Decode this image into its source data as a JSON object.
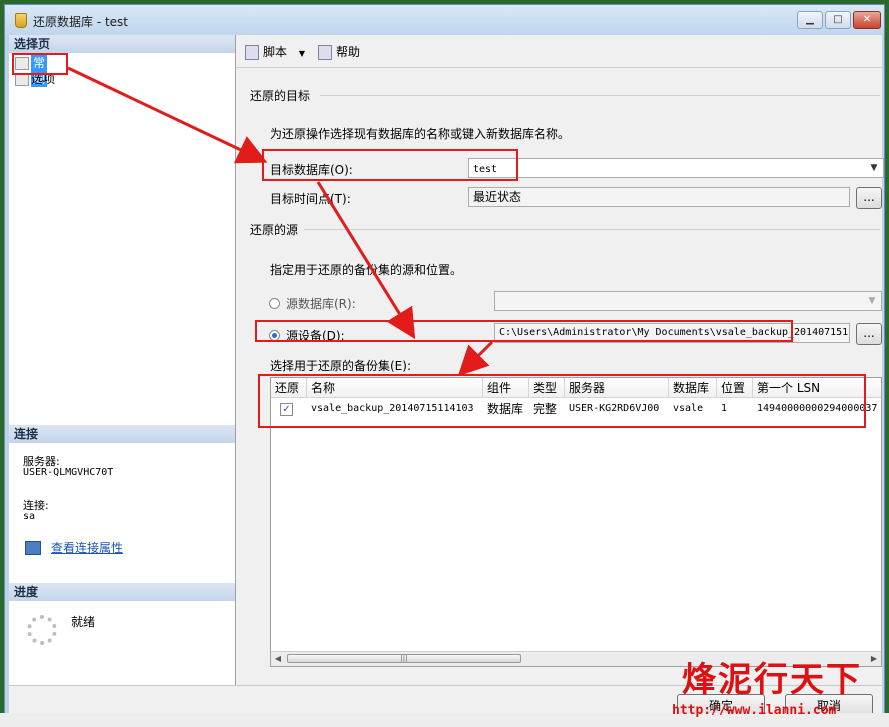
{
  "window": {
    "title": "还原数据库 - test"
  },
  "left": {
    "select_page_header": "选择页",
    "pages": [
      {
        "label": "常规"
      },
      {
        "label": "选项"
      }
    ],
    "connection_header": "连接",
    "server_label": "服务器:",
    "server_value": "USER-QLMGVHC70T",
    "conn_label": "连接:",
    "conn_value": "sa",
    "conn_props_link": "查看连接属性",
    "progress_header": "进度",
    "progress_status": "就绪"
  },
  "toolbar": {
    "script_label": "脚本",
    "help_label": "帮助"
  },
  "target": {
    "group_label": "还原的目标",
    "instruction": "为还原操作选择现有数据库的名称或键入新数据库名称。",
    "db_label": "目标数据库(O):",
    "db_value": "test",
    "time_label": "目标时间点(T):",
    "time_value": "最近状态",
    "ellipsis": "..."
  },
  "source": {
    "group_label": "还原的源",
    "instruction": "指定用于还原的备份集的源和位置。",
    "src_db_label": "源数据库(R):",
    "src_device_label": "源设备(D):",
    "device_value": "C:\\Users\\Administrator\\My Documents\\vsale_backup_201407151",
    "ellipsis": "..."
  },
  "backupsets": {
    "label": "选择用于还原的备份集(E):",
    "columns": [
      "还原",
      "名称",
      "组件",
      "类型",
      "服务器",
      "数据库",
      "位置",
      "第一个 LSN"
    ],
    "rows": [
      {
        "restore": "✓",
        "name": "vsale_backup_20140715114103",
        "component": "数据库",
        "type": "完整",
        "server": "USER-KG2RD6VJ00",
        "database": "vsale",
        "position": "1",
        "first_lsn": "14940000000294000037"
      }
    ]
  },
  "buttons": {
    "ok": "确定",
    "cancel": "取消"
  },
  "watermark": {
    "brand": "烽泥行天下",
    "url": "http://www.ilanni.com"
  },
  "colors": {
    "highlight_red": "#e21b1b",
    "selected_blue": "#3399ff"
  }
}
